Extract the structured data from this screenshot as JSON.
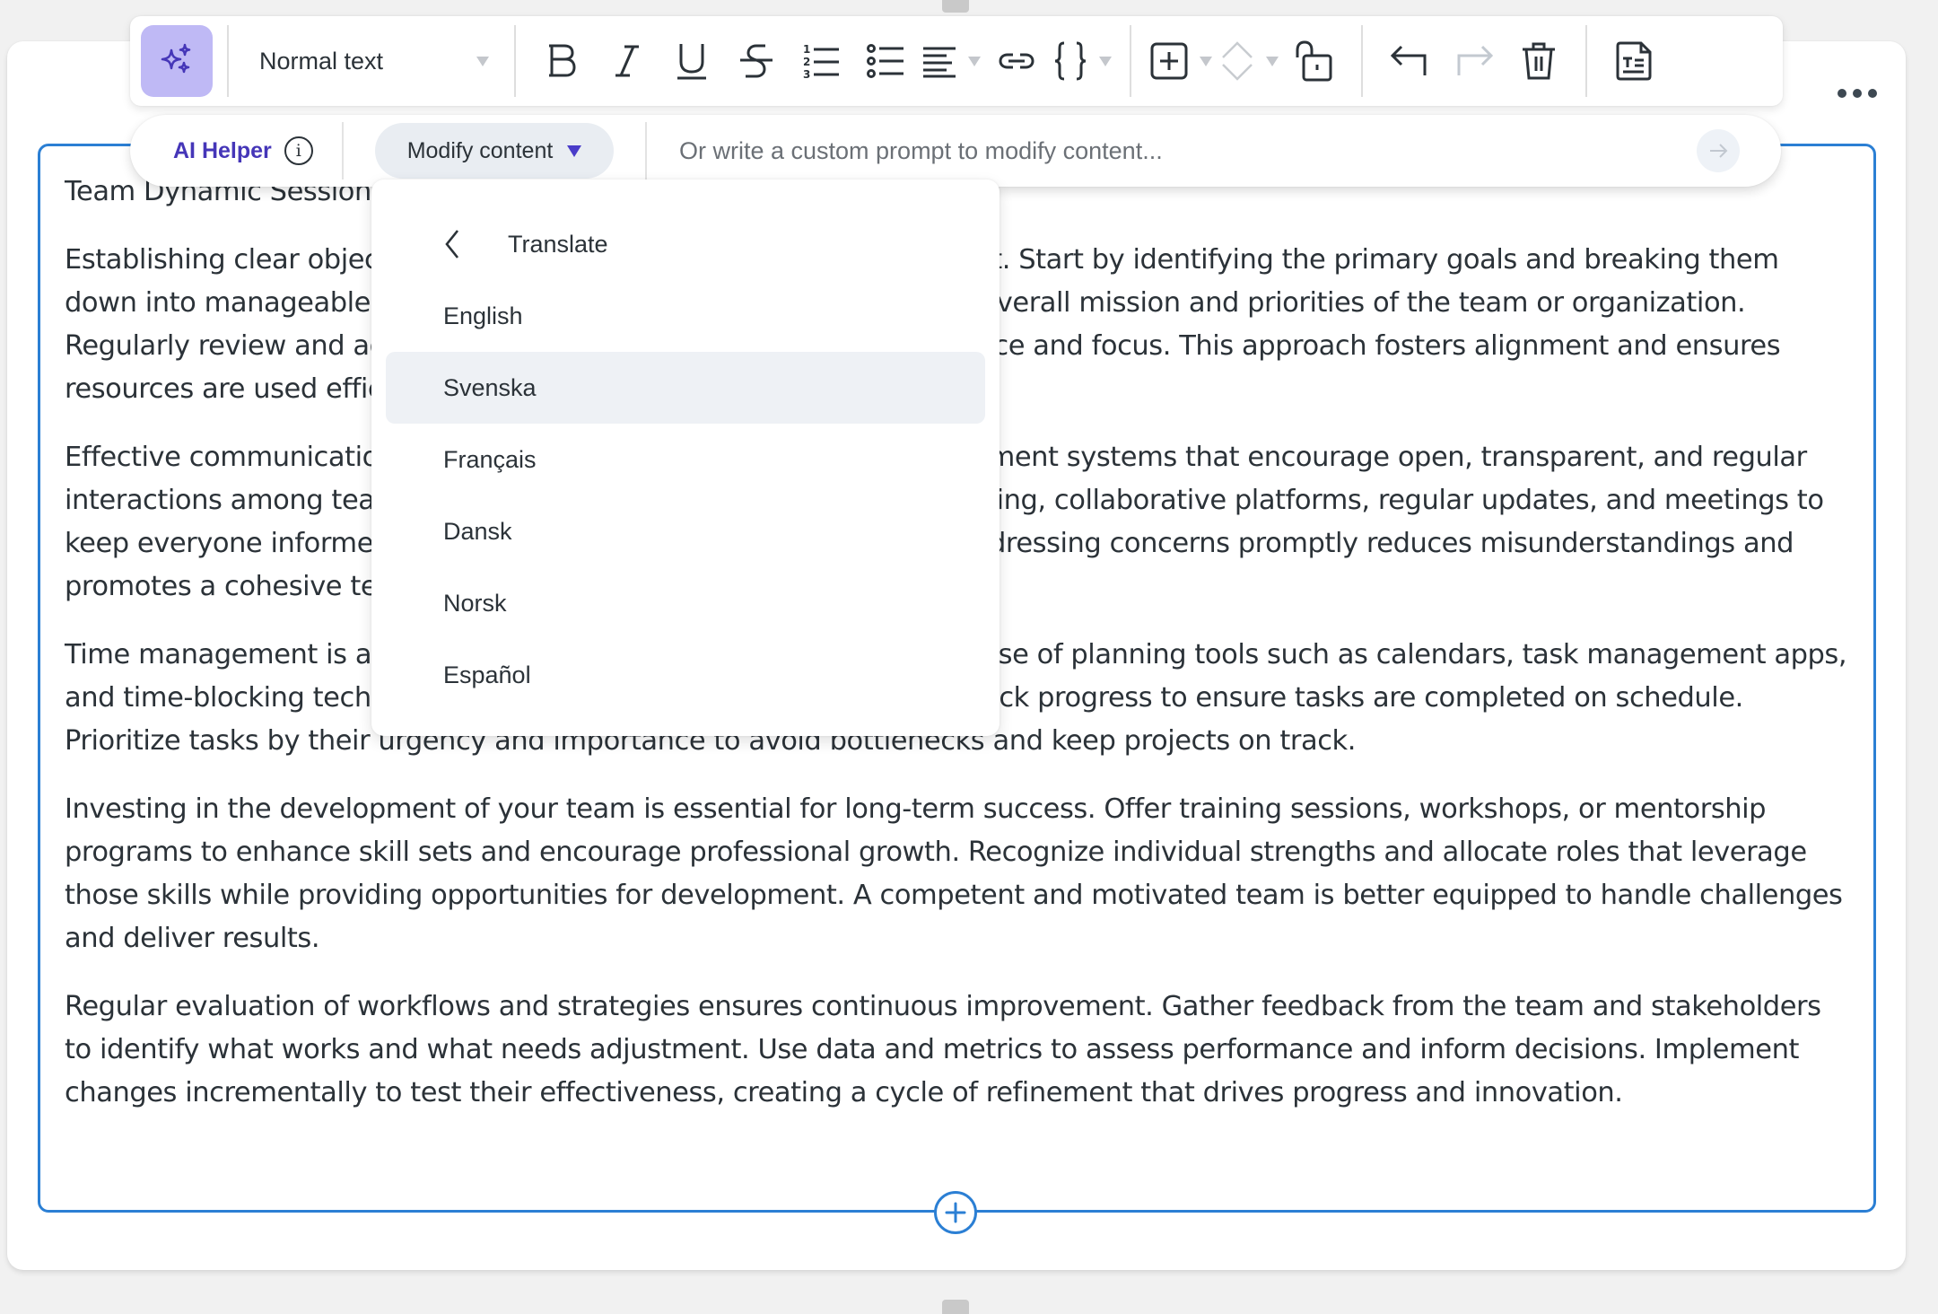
{
  "toolbar": {
    "ai_toggle_icon": "sparkles-icon",
    "text_style": "Normal text",
    "buttons": [
      {
        "name": "bold",
        "icon": "bold-icon"
      },
      {
        "name": "italic",
        "icon": "italic-icon"
      },
      {
        "name": "underline",
        "icon": "underline-icon"
      },
      {
        "name": "strikethrough",
        "icon": "strikethrough-icon"
      },
      {
        "name": "numbered-list",
        "icon": "numbered-list-icon"
      },
      {
        "name": "bullet-list",
        "icon": "bullet-list-icon"
      },
      {
        "name": "align",
        "icon": "align-left-icon",
        "has_dropdown": true
      },
      {
        "name": "link",
        "icon": "link-icon"
      },
      {
        "name": "code",
        "icon": "curly-braces-icon",
        "has_dropdown": true
      },
      {
        "name": "insert",
        "icon": "plus-square-icon",
        "has_dropdown": true
      },
      {
        "name": "move",
        "icon": "chevron-up-down-icon",
        "has_dropdown": true,
        "disabled": true
      },
      {
        "name": "lock",
        "icon": "unlock-icon"
      },
      {
        "name": "undo",
        "icon": "undo-icon"
      },
      {
        "name": "redo",
        "icon": "redo-icon",
        "disabled": true
      },
      {
        "name": "delete",
        "icon": "trash-icon"
      },
      {
        "name": "text-document",
        "icon": "text-document-icon"
      }
    ]
  },
  "ai_helper": {
    "label": "AI Helper",
    "info_icon": "i",
    "modify_button": "Modify content",
    "prompt_placeholder": "Or write a custom prompt to modify content...",
    "prompt_value": ""
  },
  "dropdown": {
    "header": "Translate",
    "items": [
      {
        "label": "English",
        "active": false
      },
      {
        "label": "Svenska",
        "active": true
      },
      {
        "label": "Français",
        "active": false
      },
      {
        "label": "Dansk",
        "active": false
      },
      {
        "label": "Norsk",
        "active": false
      },
      {
        "label": "Español",
        "active": false
      }
    ]
  },
  "document": {
    "title": "Team Dynamic Session",
    "paragraphs": [
      "Establishing clear objectives is crucial for effective team management. Start by identifying the primary goals and breaking them down into manageable tasks. Ensure these objectives align with the overall mission and priorities of the team or organization. Regularly review and adjust objectives as needed to maintain relevance and focus. This approach fosters alignment and ensures resources are used efficiently.",
      "Effective communication is the backbone of a successful team. Implement systems that encourage open, transparent, and regular interactions among team members. Use tools such as instant messaging, collaborative platforms, regular updates, and meetings to keep everyone informed and engaged. Encouraging feedback and addressing concerns promptly reduces misunderstandings and promotes a cohesive team environment.",
      "Time management is a critical aspect of productivity. Encourage the use of planning tools such as calendars, task management apps, and time-blocking techniques. Set realistic deadlines and regularly track progress to ensure tasks are completed on schedule. Prioritize tasks by their urgency and importance to avoid bottlenecks and keep projects on track.",
      "Investing in the development of your team is essential for long-term success. Offer training sessions, workshops, or mentorship programs to enhance skill sets and encourage professional growth. Recognize individual strengths and allocate roles that leverage those skills while providing opportunities for development. A competent and motivated team is better equipped to handle challenges and deliver results.",
      "Regular evaluation of workflows and strategies ensures continuous improvement. Gather feedback from the team and stakeholders to identify what works and what needs adjustment. Use data and metrics to assess performance and inform decisions. Implement changes incrementally to test their effectiveness, creating a cycle of refinement that drives progress and innovation."
    ]
  },
  "colors": {
    "accent_blue": "#2b7fd4",
    "ai_purple": "#4536b8",
    "ai_toggle_bg": "#bfb9f5",
    "text": "#2b3238",
    "active_item_bg": "#eef1f5"
  }
}
